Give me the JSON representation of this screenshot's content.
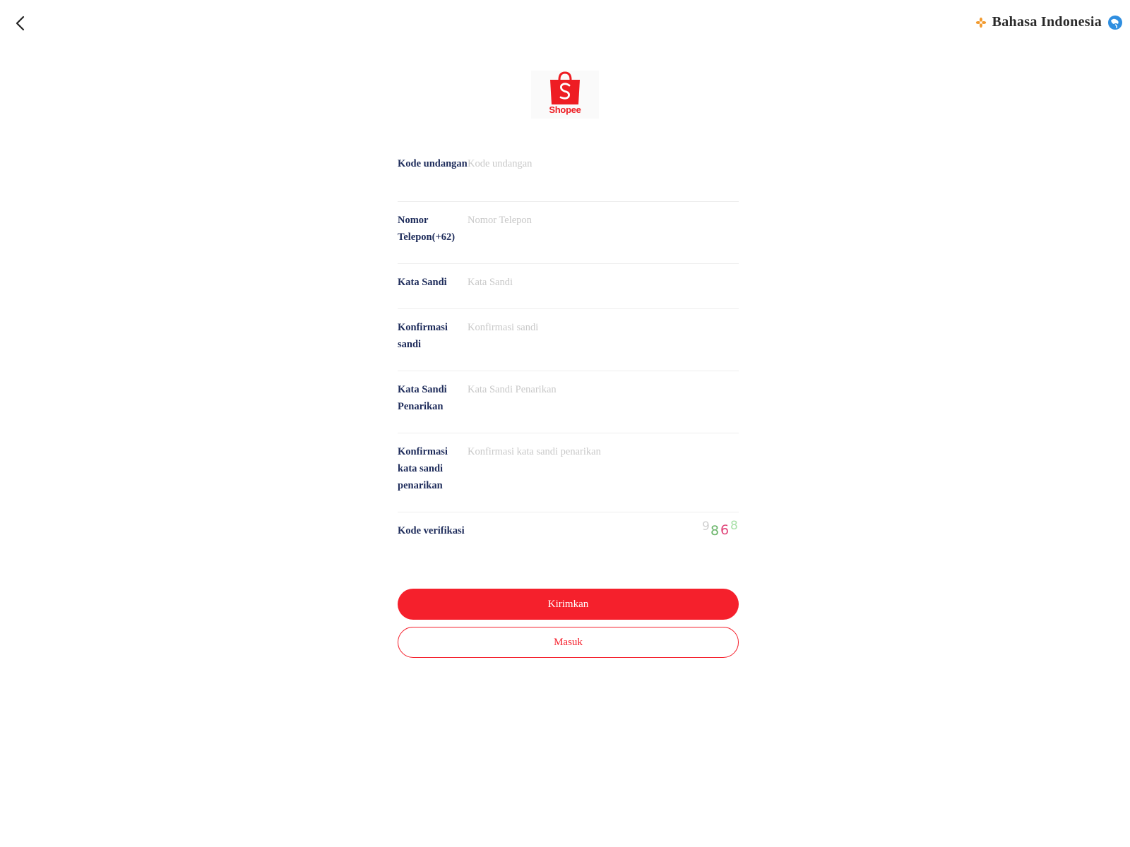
{
  "header": {
    "back_icon": "chevron-left-icon",
    "language_label": "Bahasa Indonesia",
    "language_icon": "flower-icon",
    "globe_icon": "globe-icon"
  },
  "logo": {
    "icon": "shopping-bag-icon",
    "text": "Shopee",
    "color": "#ee1d23"
  },
  "form": {
    "fields": [
      {
        "label": "Kode undangan",
        "placeholder": "Kode undangan",
        "value": ""
      },
      {
        "label": "Nomor Telepon(+62)",
        "placeholder": "Nomor Telepon",
        "value": ""
      },
      {
        "label": "Kata Sandi",
        "placeholder": "Kata Sandi",
        "value": ""
      },
      {
        "label": "Konfirmasi sandi",
        "placeholder": "Konfirmasi sandi",
        "value": ""
      },
      {
        "label": "Kata Sandi Penarikan",
        "placeholder": "Kata Sandi Penarikan",
        "value": ""
      },
      {
        "label": "Konfirmasi kata sandi penarikan",
        "placeholder": "Konfirmasi kata sandi penarikan",
        "value": ""
      }
    ],
    "verification": {
      "label": "Kode verifikasi",
      "placeholder": "",
      "captcha_digits": [
        "9",
        "8",
        "6",
        "8"
      ],
      "captcha_colors": [
        "#d0d0d0",
        "#6bb56b",
        "#e0457a",
        "#a8e0a8"
      ]
    }
  },
  "buttons": {
    "submit_label": "Kirimkan",
    "login_label": "Masuk"
  },
  "colors": {
    "accent": "#f5202c",
    "label": "#1d2b5a",
    "placeholder": "#c8c8c8"
  }
}
